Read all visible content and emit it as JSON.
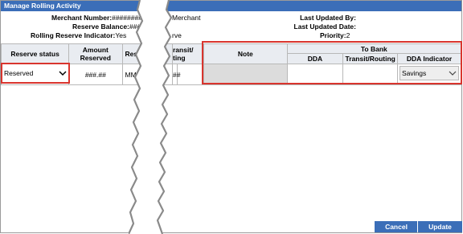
{
  "window": {
    "title": "Manage Rolling Activity"
  },
  "header_left": {
    "merchant_number_label": "Merchant Number:",
    "merchant_number_value": "#########",
    "reserve_balance_label": "Reserve Balance:",
    "reserve_balance_value": "###.##",
    "rolling_reserve_indicator_label": "Rolling Reserve Indicator:",
    "rolling_reserve_indicator_value": "Yes"
  },
  "header_mid": {
    "partial_1": "Merchant",
    "partial_2": "rve"
  },
  "header_right": {
    "last_updated_by_label": "Last Updated By:",
    "last_updated_date_label": "Last Updated Date:",
    "priority_label": "Priority:",
    "priority_value": "2"
  },
  "table": {
    "headers": {
      "reserve_status": "Reserve status",
      "amount_reserved": "Amount Reserved",
      "reserve_partial": "Rese",
      "transit_partial": "ransit/",
      "transit_partial2": "ting",
      "note": "Note",
      "to_bank": "To Bank",
      "dda": "DDA",
      "transit_routing": "Transit/Routing",
      "dda_indicator": "DDA Indicator"
    },
    "row": {
      "reserve_status": "Reserved",
      "amount_reserved": "###.##",
      "date_partial": "MM/",
      "transit_partial": "##",
      "note": "",
      "dda": "",
      "transit_routing": "",
      "dda_indicator": "Savings"
    }
  },
  "buttons": {
    "cancel": "Cancel",
    "update": "Update"
  },
  "colors": {
    "titlebar": "#3b6eb8",
    "highlight": "#d9352e",
    "header_bg": "#e9ecf1"
  }
}
